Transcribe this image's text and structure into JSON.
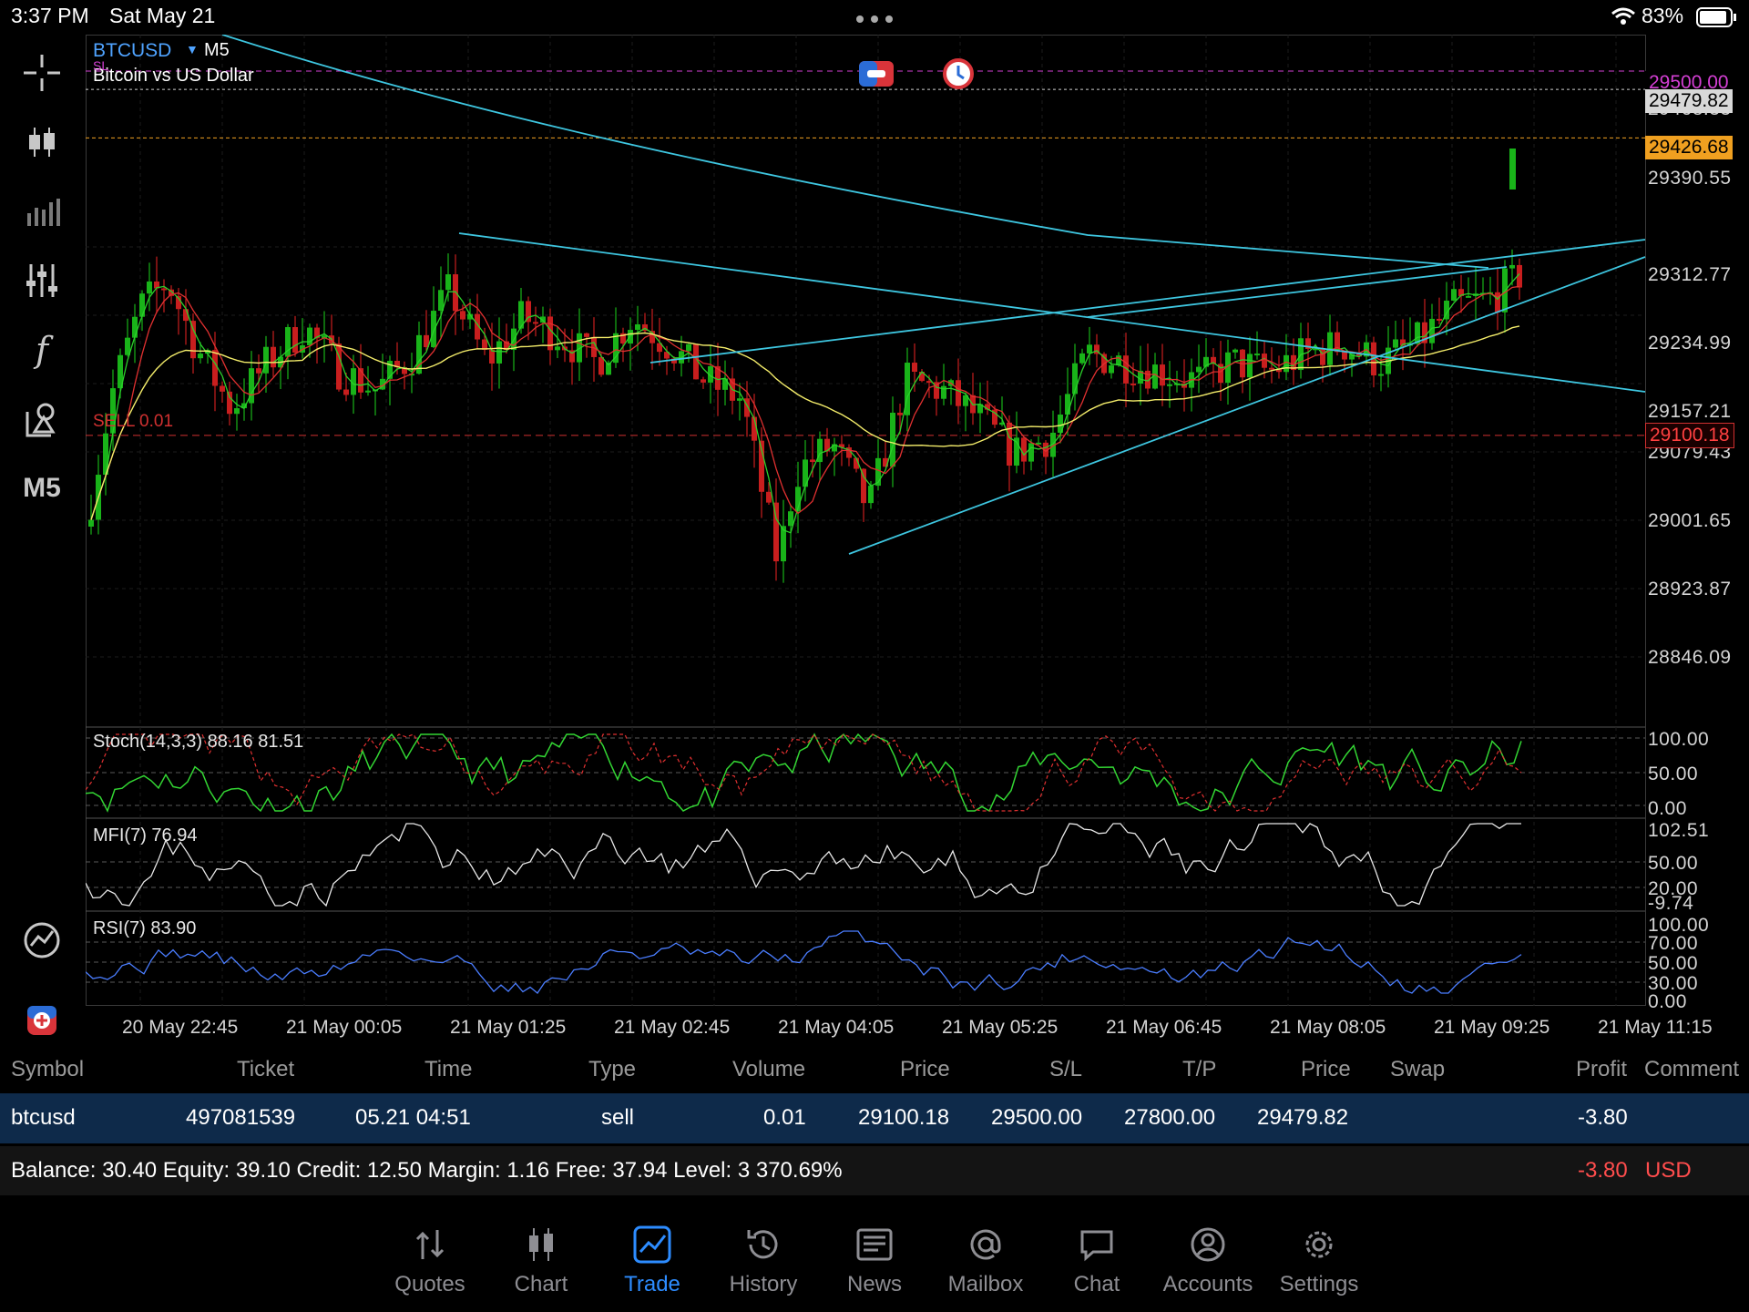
{
  "status_bar": {
    "time": "3:37 PM",
    "date": "Sat May 21",
    "battery": "83%"
  },
  "left_tools": {
    "timeframe": "M5",
    "function_label": "f"
  },
  "chart": {
    "symbol": "BTCUSD",
    "timeframe": "M5",
    "description": "Bitcoin vs US Dollar",
    "sl_tag": "SL",
    "sell_label": "SELL 0.01",
    "price_axis": [
      "29312.77",
      "29234.99",
      "29157.21",
      "29079.43",
      "29001.65",
      "28923.87",
      "28846.09",
      "29390.55",
      "29468.33"
    ],
    "tags": {
      "sl_price": "29500.00",
      "current_price": "29479.82",
      "bid": "29426.68",
      "entry": "29100.18"
    },
    "time_axis": [
      "20 May 22:45",
      "21 May 00:05",
      "21 May 01:25",
      "21 May 02:45",
      "21 May 04:05",
      "21 May 05:25",
      "21 May 06:45",
      "21 May 08:05",
      "21 May 09:25",
      "21 May 11:15"
    ],
    "stoch": {
      "label": "Stoch(14,3,3) 88.16 81.51",
      "axis": [
        "100.00",
        "50.00",
        "0.00"
      ]
    },
    "mfi": {
      "label": "MFI(7) 76.94",
      "axis": [
        "102.51",
        "50.00",
        "20.00",
        "-9.74"
      ]
    },
    "rsi": {
      "label": "RSI(7) 83.90",
      "axis": [
        "100.00",
        "70.00",
        "50.00",
        "30.00",
        "0.00"
      ]
    },
    "colors": {
      "bull": "#19b319",
      "bear": "#c81e1e",
      "trend": "#3ec6e0",
      "ma_yellow": "#f3ec6a",
      "sl_line": "#d43fd4",
      "bid_line": "#f0a020",
      "entry_line": "#d03030"
    }
  },
  "chart_data": {
    "type": "line",
    "title": "BTCUSD M5",
    "y_range": [
      28800,
      29520
    ],
    "x": [
      "20 May 22:45",
      "21 May 00:05",
      "21 May 01:25",
      "21 May 02:45",
      "21 May 04:05",
      "21 May 05:25",
      "21 May 06:45",
      "21 May 08:05",
      "21 May 09:25"
    ],
    "series": [
      {
        "name": "BTCUSD",
        "values": [
          29050,
          29180,
          29230,
          29160,
          28990,
          29170,
          29140,
          29180,
          29426.68
        ]
      }
    ]
  },
  "table": {
    "headers": [
      "Symbol",
      "Ticket",
      "Time",
      "Type",
      "Volume",
      "Price",
      "S/L",
      "T/P",
      "Price",
      "Swap",
      "Profit",
      "Comment"
    ],
    "row": [
      "btcusd",
      "497081539",
      "05.21 04:51",
      "sell",
      "0.01",
      "29100.18",
      "29500.00",
      "27800.00",
      "29479.82",
      "",
      "-3.80",
      ""
    ]
  },
  "balance": {
    "text": "Balance: 30.40 Equity: 39.10 Credit: 12.50 Margin: 1.16 Free: 37.94 Level: 3 370.69%",
    "profit": "-3.80",
    "currency": "USD"
  },
  "tabs": [
    {
      "label": "Quotes",
      "icon": "quotes-icon"
    },
    {
      "label": "Chart",
      "icon": "chart-icon"
    },
    {
      "label": "Trade",
      "icon": "trade-icon"
    },
    {
      "label": "History",
      "icon": "history-icon"
    },
    {
      "label": "News",
      "icon": "news-icon"
    },
    {
      "label": "Mailbox",
      "icon": "mailbox-icon"
    },
    {
      "label": "Chat",
      "icon": "chat-icon"
    },
    {
      "label": "Accounts",
      "icon": "accounts-icon"
    },
    {
      "label": "Settings",
      "icon": "settings-icon"
    }
  ]
}
